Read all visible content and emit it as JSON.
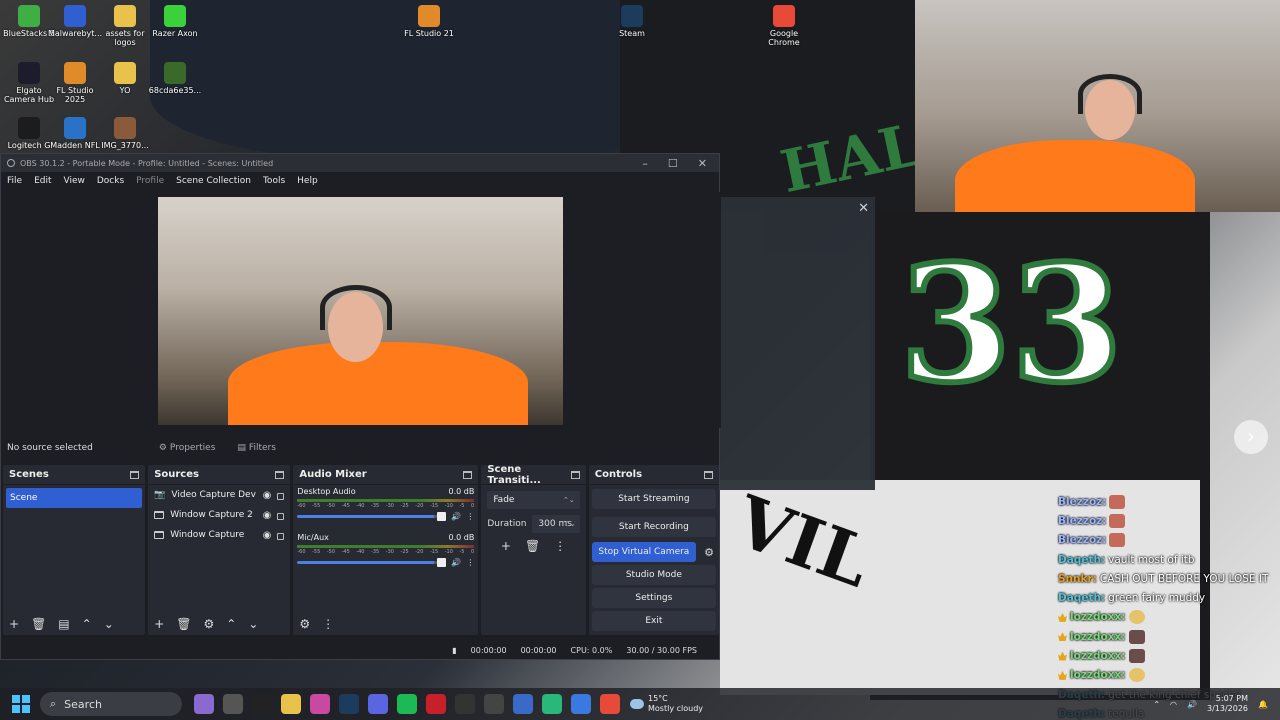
{
  "desktop_icons": [
    {
      "label": "BlueStacks 5",
      "color": "#3fae44"
    },
    {
      "label": "Malwarebyt...",
      "color": "#2f5fd1"
    },
    {
      "label": "assets for logos",
      "color": "#e8c24a"
    },
    {
      "label": "Razer Axon",
      "color": "#3ad13a"
    },
    {
      "label": "FL Studio 21",
      "color": "#e08a2a"
    },
    {
      "label": "Steam",
      "color": "#1c3c5e"
    },
    {
      "label": "Google Chrome",
      "color": "#e84a3a"
    },
    {
      "label": "Elgato Camera Hub",
      "color": "#1c1c2c"
    },
    {
      "label": "FL Studio 2025",
      "color": "#e08a2a"
    },
    {
      "label": "YO",
      "color": "#e8c24a"
    },
    {
      "label": "68cda6e35...",
      "color": "#3a6a2a"
    },
    {
      "label": "Logitech G",
      "color": "#1c1c1c"
    },
    {
      "label": "Madden NFL",
      "color": "#2a72c8"
    },
    {
      "label": "IMG_3770...",
      "color": "#8a5a3a"
    }
  ],
  "obs": {
    "title": "OBS 30.1.2 - Portable Mode - Profile: Untitled - Scenes: Untitled",
    "menu": [
      "File",
      "Edit",
      "View",
      "Docks",
      "Profile",
      "Scene Collection",
      "Tools",
      "Help"
    ],
    "no_source": "No source selected",
    "properties_label": "Properties",
    "filters_label": "Filters",
    "docks": {
      "scenes_title": "Scenes",
      "sources_title": "Sources",
      "mixer_title": "Audio Mixer",
      "transitions_title": "Scene Transiti...",
      "controls_title": "Controls"
    },
    "scenes": [
      "Scene"
    ],
    "sources": [
      "Video Capture Dev",
      "Window Capture 2",
      "Window Capture"
    ],
    "mixer": [
      {
        "name": "Desktop Audio",
        "db": "0.0 dB",
        "level": 0.92
      },
      {
        "name": "Mic/Aux",
        "db": "0.0 dB",
        "level": 0.92
      }
    ],
    "meter_scale": [
      "-60",
      "-55",
      "-50",
      "-45",
      "-40",
      "-35",
      "-30",
      "-25",
      "-20",
      "-15",
      "-10",
      "-5",
      "0"
    ],
    "transition": {
      "type": "Fade",
      "duration_label": "Duration",
      "duration": "300 ms"
    },
    "controls": [
      "Start Streaming",
      "Start Recording",
      "Stop Virtual Camera",
      "Studio Mode",
      "Settings",
      "Exit"
    ],
    "status": {
      "stream_time": "00:00:00",
      "rec_time": "00:00:00",
      "cpu": "CPU: 0.0%",
      "fps": "30.00 / 30.00 FPS"
    }
  },
  "chat": [
    {
      "user": "Blezzoz:",
      "color": "#9ab4ff",
      "text": "",
      "badge": false,
      "emote": "r"
    },
    {
      "user": "Blezzoz:",
      "color": "#9ab4ff",
      "text": "",
      "badge": false,
      "emote": "r"
    },
    {
      "user": "Blezzoz:",
      "color": "#9ab4ff",
      "text": "",
      "badge": false,
      "emote": "r"
    },
    {
      "user": "Daqeth:",
      "color": "#4fc3d9",
      "text": "vault most of itb",
      "badge": false,
      "emote": ""
    },
    {
      "user": "Snnkr:",
      "color": "#e8a020",
      "text": "CASH OUT BEFORE YOU LOSE IT",
      "badge": false,
      "emote": ""
    },
    {
      "user": "Daqeth:",
      "color": "#4fc3d9",
      "text": "green fairy muddy",
      "badge": false,
      "emote": ""
    },
    {
      "user": "lozzdoxx:",
      "color": "#7ad97a",
      "text": "",
      "badge": true,
      "emote": "y"
    },
    {
      "user": "lozzdoxx:",
      "color": "#7ad97a",
      "text": "",
      "badge": true,
      "emote": "d"
    },
    {
      "user": "lozzdoxx:",
      "color": "#7ad97a",
      "text": "",
      "badge": true,
      "emote": "d"
    },
    {
      "user": "lozzdoxx:",
      "color": "#7ad97a",
      "text": "",
      "badge": true,
      "emote": "y"
    },
    {
      "user": "Daqeth:",
      "color": "#4fc3d9",
      "text": "get the king chief special",
      "badge": false,
      "emote": ""
    },
    {
      "user": "Daqeth:",
      "color": "#4fc3d9",
      "text": "tequila",
      "badge": false,
      "emote": ""
    }
  ],
  "taskbar": {
    "search_label": "Search",
    "weather_temp": "15°C",
    "weather_desc": "Mostly cloudy",
    "time": "5:07 PM",
    "date": "3/13/2026",
    "apps": [
      "#8a6ad1",
      "#555",
      "#222",
      "#e8c24a",
      "#c84aa0",
      "#1c3c5e",
      "#5a66e0",
      "#1db954",
      "#c8202a",
      "#333",
      "#444",
      "#3a6ac8",
      "#2ab87a",
      "#3a7ae0",
      "#e84a3a"
    ]
  }
}
